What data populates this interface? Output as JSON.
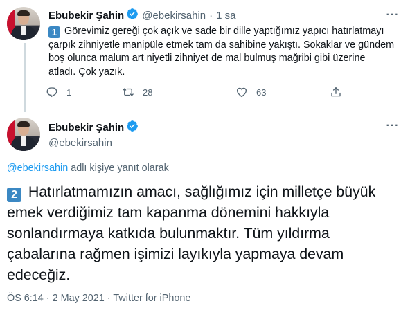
{
  "tweet1": {
    "author_name": "Ebubekir Şahin",
    "handle": "@ebekirsahin",
    "separator": "·",
    "time_ago": "1 sa",
    "body_keycap": "1",
    "body_text": "Görevimiz gereği çok açık ve sade bir dille yaptığımız yapıcı hatırlatmayı çarpık zihniyetle manipüle etmek tam da sahibine yakıştı. Sokaklar ve gündem boş olunca malum art niyetli zihniyet de mal bulmuş mağribi gibi üzerine atladı. Çok yazık.",
    "replies": "1",
    "retweets": "28",
    "likes": "63"
  },
  "tweet2": {
    "author_name": "Ebubekir Şahin",
    "handle": "@ebekirsahin",
    "reply_handle": "@ebekirsahin",
    "reply_suffix": " adlı kişiye yanıt olarak",
    "body_keycap": "2",
    "body_text": "Hatırlatmamızın amacı, sağlığımız için milletçe büyük emek verdiğimiz tam kapanma dönemini hakkıyla sonlandırmaya katkıda bulunmaktır. Tüm yıldırma çabalarına rağmen işimizi layıkıyla yapmaya devam edeceğiz.",
    "time": "ÖS 6:14",
    "separator1": "·",
    "date": "2 May 2021",
    "separator2": "·",
    "source": "Twitter for iPhone"
  },
  "icons": {
    "verified": "verified-badge-icon",
    "more": "more-dots-icon",
    "reply": "reply-icon",
    "retweet": "retweet-icon",
    "like": "heart-icon",
    "share": "share-icon"
  },
  "colors": {
    "accent": "#1d9bf0",
    "keycap": "#3b88c3",
    "muted": "#536471",
    "text": "#0f1419"
  }
}
